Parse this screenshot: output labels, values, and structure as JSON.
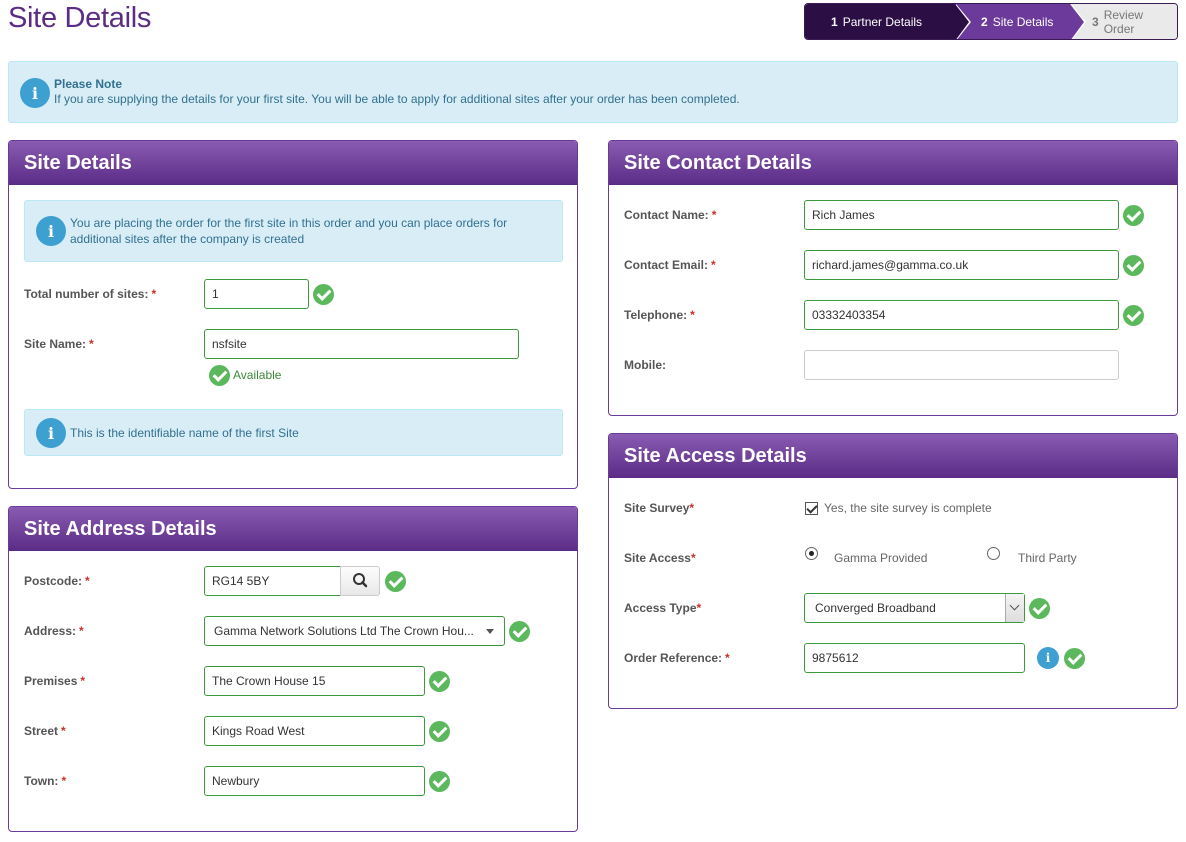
{
  "page": {
    "title": "Site Details"
  },
  "stepper": {
    "steps": [
      {
        "num": "1",
        "label": "Partner Details"
      },
      {
        "num": "2",
        "label": "Site Details"
      },
      {
        "num": "3",
        "label": "Review Order"
      }
    ]
  },
  "note": {
    "title": "Please Note",
    "text": "If you are supplying the details for your first site. You will be able to apply for additional sites after your order has been completed."
  },
  "site_details": {
    "heading": "Site Details",
    "alert_line1": "You are placing the order for the first site in this order and you can place orders for",
    "alert_line2": "additional sites after the company is created",
    "total_sites_label": "Total number of sites:",
    "total_sites_value": "1",
    "site_name_label": "Site Name:",
    "site_name_value": "nsfsite",
    "available_text": "Available",
    "name_alert": "This is the identifiable name of the first Site"
  },
  "site_address": {
    "heading": "Site Address Details",
    "postcode_label": "Postcode:",
    "postcode_value": "RG14 5BY",
    "address_label": "Address:",
    "address_value": "Gamma Network Solutions Ltd The Crown Hou...",
    "premises_label": "Premises",
    "premises_value": "The Crown House 15",
    "street_label": "Street",
    "street_value": "Kings Road West",
    "town_label": "Town:",
    "town_value": "Newbury"
  },
  "site_contact": {
    "heading": "Site Contact Details",
    "contact_name_label": "Contact Name:",
    "contact_name_value": "Rich James",
    "contact_email_label": "Contact Email:",
    "contact_email_value": "richard.james@gamma.co.uk",
    "telephone_label": "Telephone:",
    "telephone_value": "03332403354",
    "mobile_label": "Mobile:",
    "mobile_value": ""
  },
  "site_access": {
    "heading": "Site Access Details",
    "survey_label": "Site Survey",
    "survey_option": "Yes, the site survey is complete",
    "access_label": "Site Access",
    "access_option_1": "Gamma Provided",
    "access_option_2": "Third Party",
    "access_type_label": "Access Type",
    "access_type_value": "Converged Broadband",
    "order_ref_label": "Order Reference:",
    "order_ref_value": "9875612"
  },
  "required_marker": "*",
  "colors": {
    "brand_purple": "#5b2c86",
    "success_green": "#5cb85c",
    "info_blue": "#3da0d0"
  }
}
